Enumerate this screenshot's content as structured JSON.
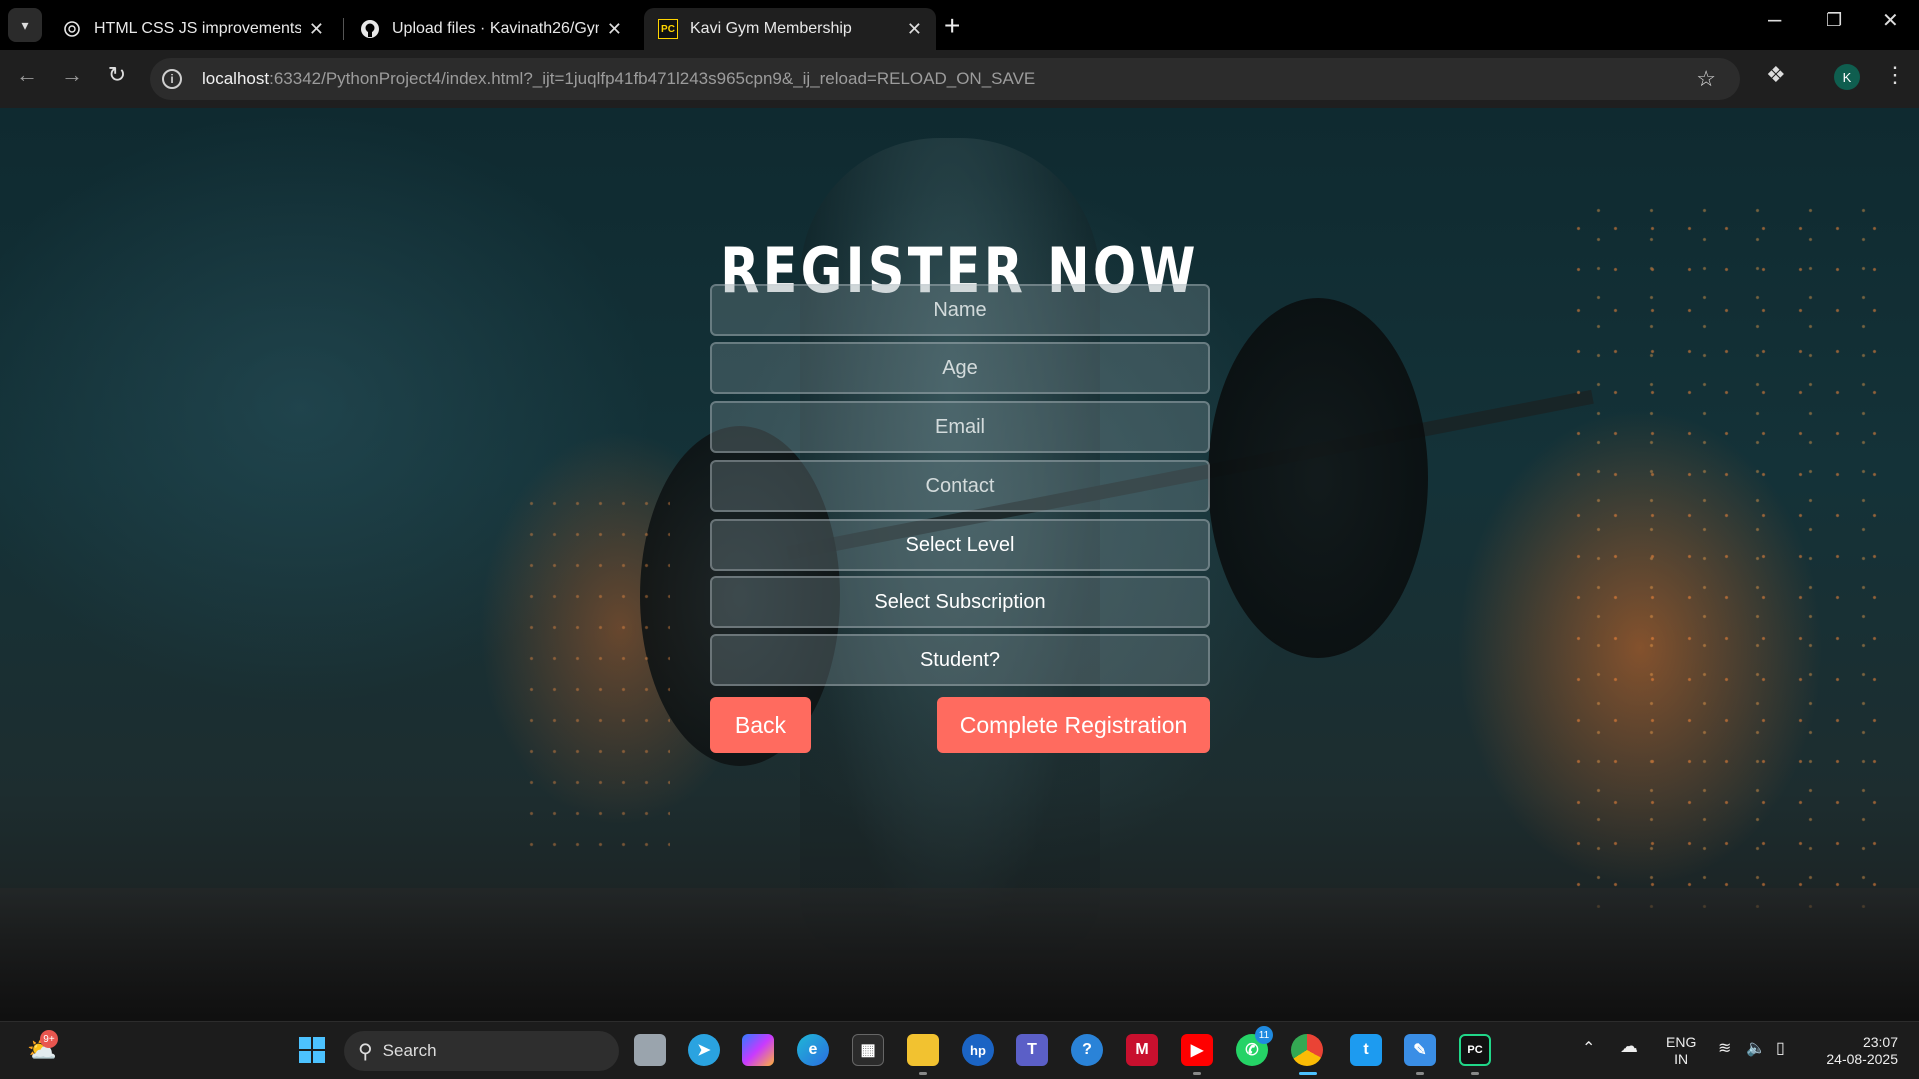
{
  "browser": {
    "tabs": [
      {
        "title": "HTML CSS JS improvements",
        "icon": "openai-icon"
      },
      {
        "title": "Upload files · Kavinath26/Gym_",
        "icon": "github-icon"
      },
      {
        "title": "Kavi Gym Membership",
        "icon": "pycharm-icon",
        "active": true
      }
    ],
    "new_tab": "+",
    "url_host": "localhost",
    "url_rest": ":63342/PythonProject4/index.html?_ijt=1juqlfp41fb471l243s965cpn9&_ij_reload=RELOAD_ON_SAVE",
    "profile_initial": "K"
  },
  "page": {
    "title": "REGISTER NOW",
    "fields": {
      "name": "Name",
      "age": "Age",
      "email": "Email",
      "contact": "Contact",
      "level": "Select Level",
      "subscription": "Select Subscription",
      "student": "Student?"
    },
    "back_label": "Back",
    "submit_label": "Complete Registration",
    "accent_color": "#ff6b5f"
  },
  "taskbar": {
    "weather_badge": "9+",
    "search_label": "Search",
    "whatsapp_badge": "11",
    "lang_line1": "ENG",
    "lang_line2": "IN",
    "time": "23:07",
    "date": "24-08-2025"
  }
}
